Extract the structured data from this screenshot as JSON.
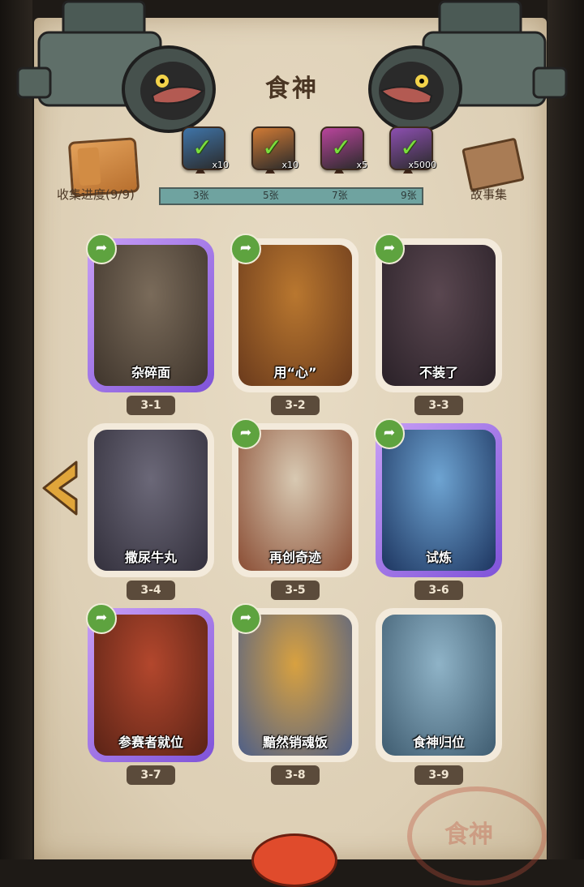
{
  "title": "食神",
  "collection": {
    "label": "收集进度(9/9)",
    "icon": "book-icon"
  },
  "story": {
    "label": "故事集",
    "icon": "story-box-icon"
  },
  "progress": {
    "ticks": [
      "3张",
      "5张",
      "7张",
      "9张"
    ],
    "fraction": 1.0
  },
  "rewards": [
    {
      "count": "x10",
      "color": "#3f74a8",
      "name": "chest-reward-icon"
    },
    {
      "count": "x10",
      "color": "#d07a35",
      "name": "key-reward-icon"
    },
    {
      "count": "x5",
      "color": "#b9459c",
      "name": "orb-reward-icon"
    },
    {
      "count": "x5000",
      "color": "#8c4fb0",
      "name": "ticket-reward-icon"
    }
  ],
  "cards": [
    {
      "label": "杂碎面",
      "num": "3-1",
      "rarity": "purple",
      "share": true,
      "bg": [
        "#7a6b5a",
        "#3f352c"
      ]
    },
    {
      "label": "用“心”",
      "num": "3-2",
      "rarity": "normal",
      "share": true,
      "bg": [
        "#b9772f",
        "#6a3a1c"
      ]
    },
    {
      "label": "不装了",
      "num": "3-3",
      "rarity": "normal",
      "share": true,
      "bg": [
        "#5a4750",
        "#2a2128"
      ]
    },
    {
      "label": "撒尿牛丸",
      "num": "3-4",
      "rarity": "normal",
      "share": false,
      "bg": [
        "#6b6878",
        "#33303c"
      ]
    },
    {
      "label": "再创奇迹",
      "num": "3-5",
      "rarity": "normal",
      "share": true,
      "bg": [
        "#d8c9b2",
        "#8a4d34"
      ]
    },
    {
      "label": "试炼",
      "num": "3-6",
      "rarity": "purple",
      "share": true,
      "bg": [
        "#6ea4d2",
        "#1d3560"
      ]
    },
    {
      "label": "参赛者就位",
      "num": "3-7",
      "rarity": "purple",
      "share": true,
      "bg": [
        "#b3472d",
        "#5a2316"
      ]
    },
    {
      "label": "黯然销魂饭",
      "num": "3-8",
      "rarity": "normal",
      "share": true,
      "bg": [
        "#d8a140",
        "#4e5f88"
      ]
    },
    {
      "label": "食神归位",
      "num": "3-9",
      "rarity": "normal",
      "share": false,
      "bg": [
        "#8fb3c7",
        "#3f5c70"
      ]
    }
  ],
  "nav": {
    "back_icon": "chevron-left-icon"
  },
  "stamp": {
    "text": "食神"
  }
}
